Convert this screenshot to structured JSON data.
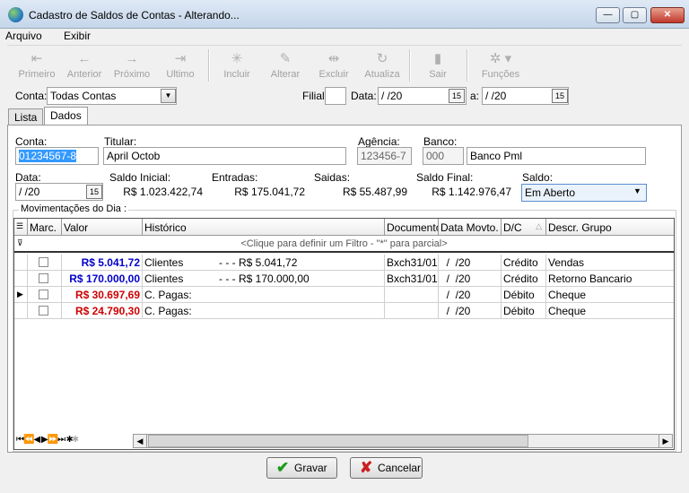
{
  "window": {
    "title": "Cadastro de Saldos de Contas - Alterando...",
    "minimize": "—",
    "maximize": "▢",
    "close": "✕"
  },
  "menu": [
    "Arquivo",
    "Exibir"
  ],
  "toolbar": {
    "primeiro": "Primeiro",
    "anterior": "Anterior",
    "proximo": "Próximo",
    "ultimo": "Ultimo",
    "incluir": "Incluir",
    "alterar": "Alterar",
    "excluir": "Excluir",
    "atualiza": "Atualiza",
    "sair": "Sair",
    "funcoes": "Funções"
  },
  "filter": {
    "conta_label": "Conta:",
    "conta_value": "Todas Contas",
    "filial_label": "Filial:",
    "filial_value": "",
    "data_label": "Data:",
    "data_from": "  /  /20",
    "a_label": "a:",
    "data_to": "  /  /20"
  },
  "tabs": [
    "Lista",
    "Dados"
  ],
  "form": {
    "conta_label": "Conta:",
    "conta_value": "01234567-8",
    "titular_label": "Titular:",
    "titular_value": "April Octob",
    "agencia_label": "Agência:",
    "agencia_value": "123456-7",
    "banco_label": "Banco:",
    "banco_code": "000",
    "banco_name": "Banco Pml",
    "data_label": "Data:",
    "data_value": "  /  /20",
    "saldo_inicial_label": "Saldo Inicial:",
    "saldo_inicial": "R$ 1.023.422,74",
    "entradas_label": "Entradas:",
    "entradas": "R$ 175.041,72",
    "saidas_label": "Saidas:",
    "saidas": "R$ 55.487,99",
    "saldo_final_label": "Saldo Final:",
    "saldo_final": "R$ 1.142.976,47",
    "saldo_label": "Saldo:",
    "saldo_value": "Em Aberto"
  },
  "movimentacoes": {
    "label": "Movimentações do Dia :",
    "columns": [
      "Marc.",
      "Valor",
      "Histórico",
      "Documento",
      "Data Movto.",
      "D/C",
      "Descr. Grupo"
    ],
    "filter_hint": "<Clique para definir um Filtro - \"*\" para parcial>",
    "rows": [
      {
        "valor": "R$ 5.041,72",
        "historico": "Clientes",
        "hist2": "- - - R$ 5.041,72",
        "documento": "Bxch31/01.",
        "data": "  /  /20",
        "dc": "Crédito",
        "grupo": "Vendas",
        "color": "#0000cc"
      },
      {
        "valor": "R$ 170.000,00",
        "historico": "Clientes",
        "hist2": "- - - R$ 170.000,00",
        "documento": "Bxch31/01.",
        "data": "  /  /20",
        "dc": "Crédito",
        "grupo": "Retorno Bancario",
        "color": "#0000cc"
      },
      {
        "valor": "R$ 30.697,69",
        "historico": "C. Pagas:",
        "hist2": "",
        "documento": "",
        "data": "  /  /20",
        "dc": "Débito",
        "grupo": "Cheque",
        "color": "#cc0000"
      },
      {
        "valor": "R$ 24.790,30",
        "historico": "C. Pagas:",
        "hist2": "",
        "documento": "",
        "data": "  /  /20",
        "dc": "Débito",
        "grupo": "Cheque",
        "color": "#cc0000"
      }
    ]
  },
  "buttons": {
    "gravar": "Gravar",
    "cancelar": "Cancelar"
  }
}
